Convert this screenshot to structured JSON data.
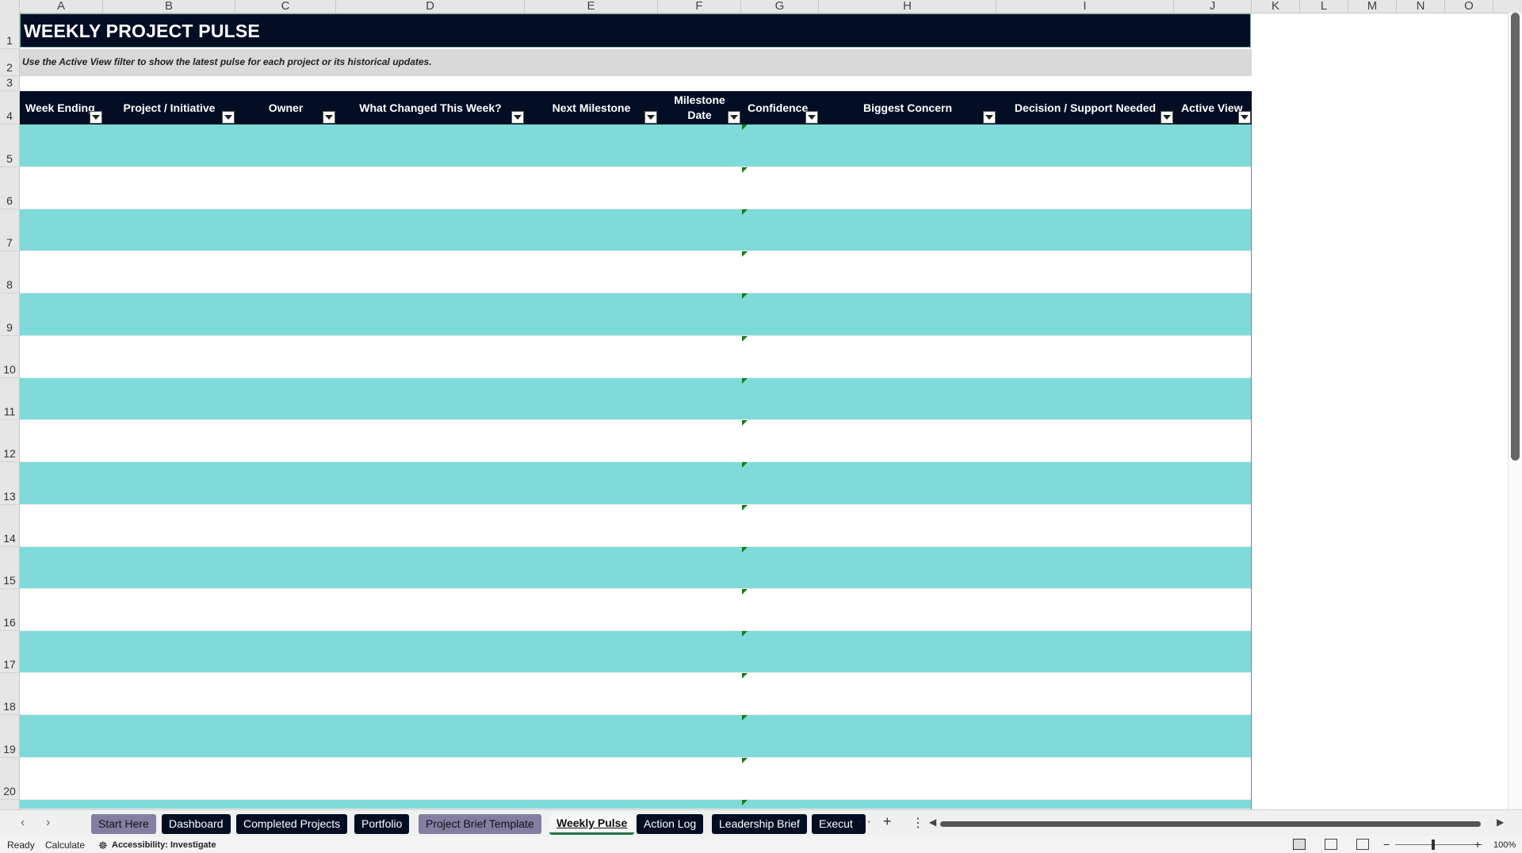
{
  "columns": [
    "A",
    "B",
    "C",
    "D",
    "E",
    "F",
    "G",
    "H",
    "I",
    "J",
    "K",
    "L",
    "M",
    "N",
    "O"
  ],
  "rows": [
    "1",
    "2",
    "3",
    "4",
    "5",
    "6",
    "7",
    "8",
    "9",
    "10",
    "11",
    "12",
    "13",
    "14",
    "15",
    "16",
    "17",
    "18",
    "19",
    "20"
  ],
  "title": "WEEKLY PROJECT PULSE",
  "subtitle": "Use the Active View filter to show the latest pulse for each project or its historical updates.",
  "table_headers": [
    "Week Ending",
    "Project / Initiative",
    "Owner",
    "What Changed This Week?",
    "Next Milestone",
    "Milestone Date",
    "Confidence",
    "Biggest Concern",
    "Decision / Support Needed",
    "Active View"
  ],
  "sheet_tabs": [
    {
      "label": "Start Here",
      "style": "grey"
    },
    {
      "label": "Dashboard",
      "style": "dark"
    },
    {
      "label": "Completed Projects",
      "style": "dark"
    },
    {
      "label": "Portfolio",
      "style": "dark"
    },
    {
      "label": "Project Brief Template",
      "style": "grey"
    },
    {
      "label": "Weekly Pulse",
      "style": "active"
    },
    {
      "label": "Action Log",
      "style": "dark"
    },
    {
      "label": "Leadership Brief",
      "style": "dark"
    },
    {
      "label": "Execut",
      "style": "dark"
    }
  ],
  "tab_controls": {
    "more": "···",
    "add": "+",
    "options": "⋮"
  },
  "status": {
    "ready": "Ready",
    "calculate": "Calculate",
    "accessibility": "Accessibility: Investigate",
    "zoom": "100%"
  },
  "colors": {
    "dark": "#030e24",
    "band": "#7fdbd9",
    "grey_tab": "#857ea3"
  }
}
